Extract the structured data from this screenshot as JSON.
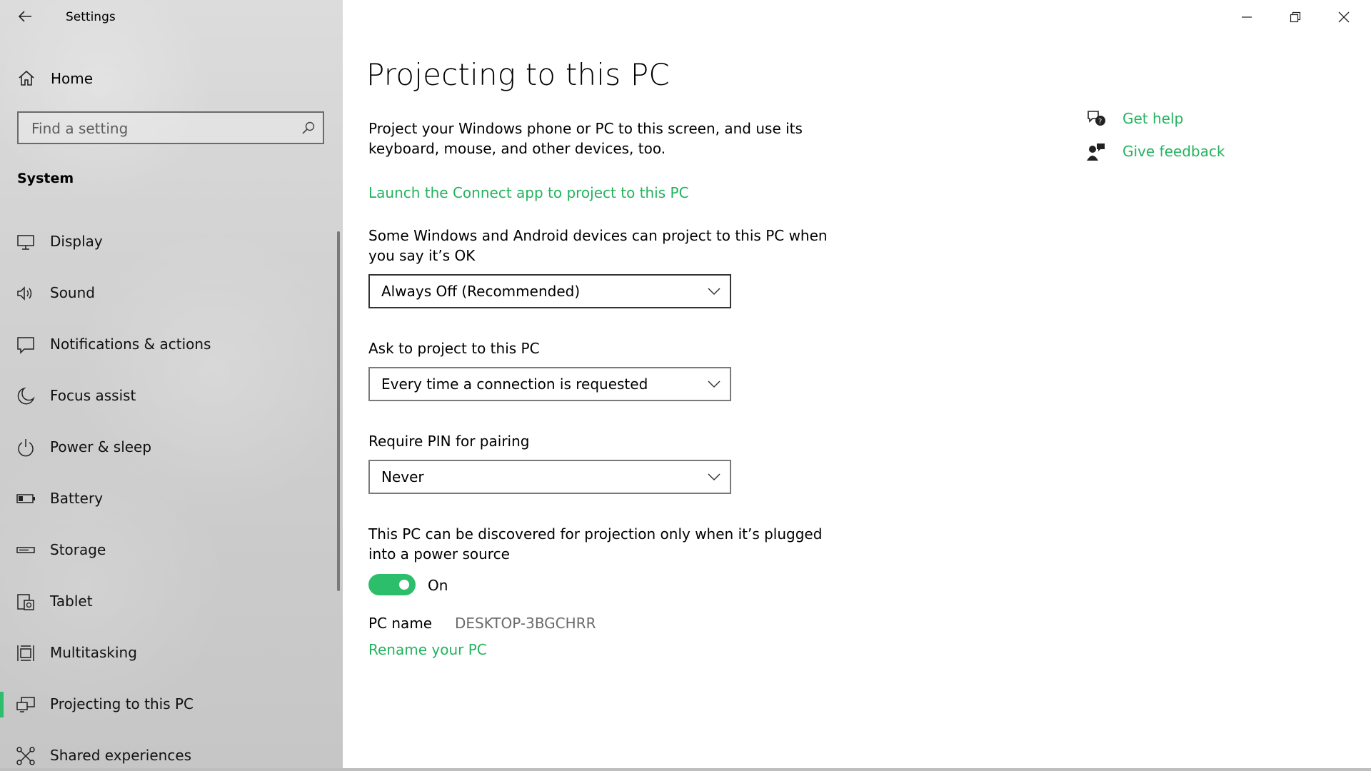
{
  "window": {
    "title": "Settings",
    "controls": [
      "minimize",
      "restore",
      "close"
    ]
  },
  "sidebar": {
    "home_label": "Home",
    "search": {
      "placeholder": "Find a setting",
      "value": ""
    },
    "section_label": "System",
    "items": [
      {
        "label": "Display",
        "icon": "display-icon",
        "active": false
      },
      {
        "label": "Sound",
        "icon": "speaker-icon",
        "active": false
      },
      {
        "label": "Notifications & actions",
        "icon": "message-icon",
        "active": false
      },
      {
        "label": "Focus assist",
        "icon": "moon-icon",
        "active": false
      },
      {
        "label": "Power & sleep",
        "icon": "power-icon",
        "active": false
      },
      {
        "label": "Battery",
        "icon": "battery-icon",
        "active": false
      },
      {
        "label": "Storage",
        "icon": "storage-drive-icon",
        "active": false
      },
      {
        "label": "Tablet",
        "icon": "tablet-icon",
        "active": false
      },
      {
        "label": "Multitasking",
        "icon": "multitasking-icon",
        "active": false
      },
      {
        "label": "Projecting to this PC",
        "icon": "projecting-icon",
        "active": true
      },
      {
        "label": "Shared experiences",
        "icon": "shared-experiences-icon",
        "active": false
      }
    ]
  },
  "main": {
    "title": "Projecting to this PC",
    "description": "Project your Windows phone or PC to this screen, and use its keyboard, mouse, and other devices, too.",
    "connect_link": "Launch the Connect app to project to this PC",
    "settings": [
      {
        "label": "Some Windows and Android devices can project to this PC when you say it’s OK",
        "value": "Always Off (Recommended)"
      },
      {
        "label": "Ask to project to this PC",
        "value": "Every time a connection is requested"
      },
      {
        "label": "Require PIN for pairing",
        "value": "Never"
      }
    ],
    "power_setting": {
      "label": "This PC can be discovered for projection only when it’s plugged into a power source",
      "state": "On",
      "enabled": true
    },
    "pc_name": {
      "label": "PC name",
      "value": "DESKTOP-3BGCHRR"
    },
    "rename_link": "Rename your PC"
  },
  "help": {
    "get_help": "Get help",
    "give_feedback": "Give feedback"
  },
  "colors": {
    "accent": "#2dbe6c",
    "link": "#22b35e",
    "sidebar_bg": "#d2d2d2"
  }
}
